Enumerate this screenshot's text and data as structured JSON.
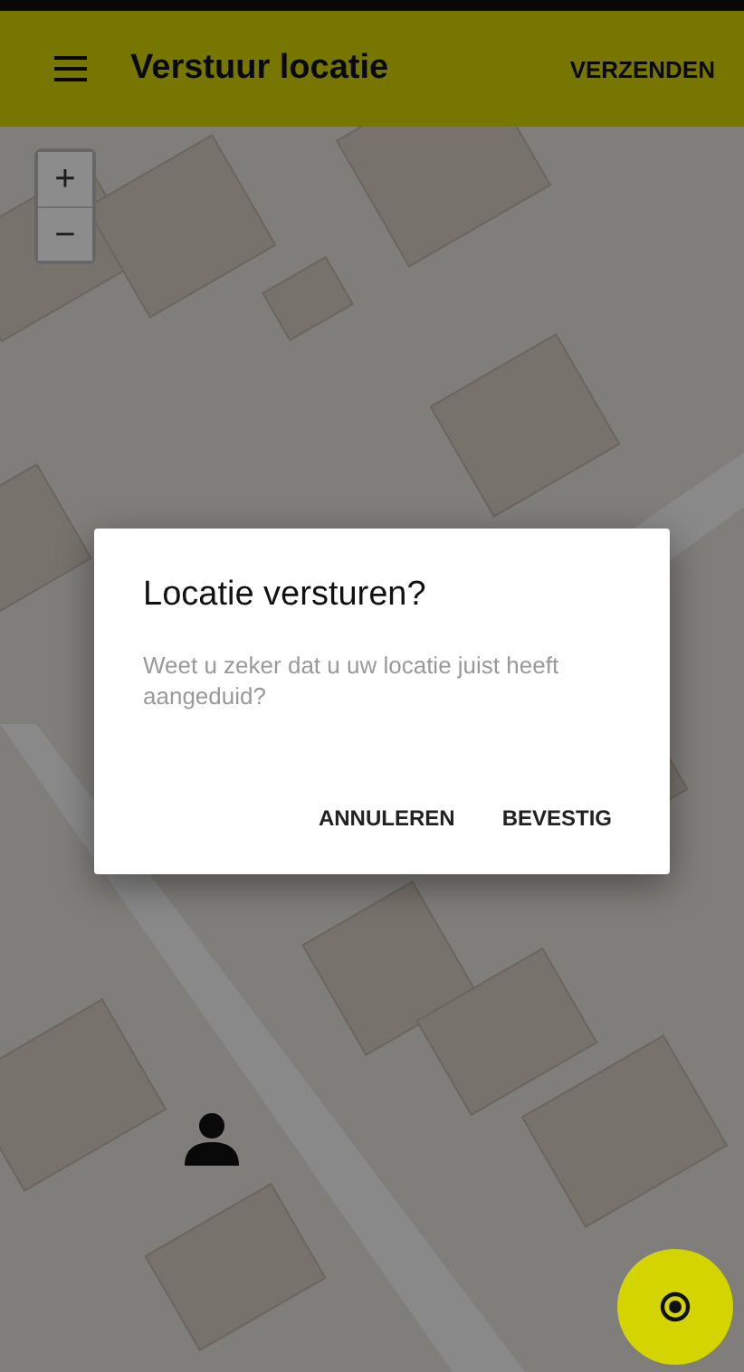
{
  "app_bar": {
    "title": "Verstuur locatie",
    "action": "VERZENDEN"
  },
  "map": {
    "kind": "picture",
    "zoom_controls": [
      "+",
      "−"
    ]
  },
  "dialog": {
    "title": "Locatie versturen?",
    "message": "Weet u zeker dat u uw locatie juist heeft aangeduid?",
    "buttons": [
      "ANNULEREN",
      "BEVESTIG"
    ]
  }
}
